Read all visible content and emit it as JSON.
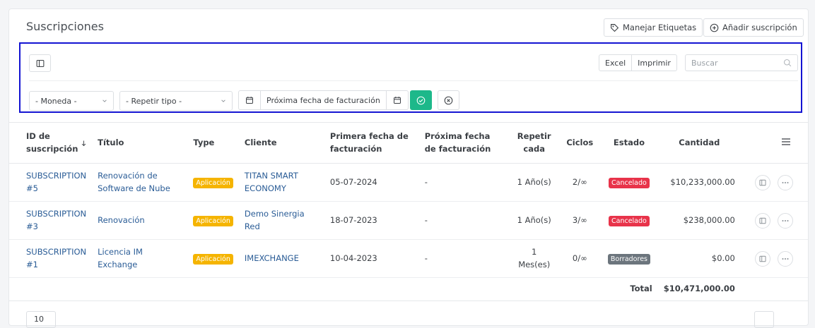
{
  "page": {
    "title": "Suscripciones"
  },
  "header": {
    "manage_tags": "Manejar Etiquetas",
    "add_subscription": "Añadir suscripción"
  },
  "toolbar": {
    "excel": "Excel",
    "print": "Imprimir",
    "search_placeholder": "Buscar",
    "currency_select": "- Moneda -",
    "repeat_type_select": "- Repetir tipo -",
    "next_billing_date": "Próxima fecha de facturación"
  },
  "table": {
    "headers": [
      "ID de suscripción",
      "Título",
      "Type",
      "Cliente",
      "Primera fecha de facturación",
      "Próxima fecha de facturación",
      "Repetir cada",
      "Ciclos",
      "Estado",
      "Cantidad"
    ],
    "rows": [
      {
        "id": "SUBSCRIPTION #5",
        "title": "Renovación de Software de Nube",
        "type": "Aplicación",
        "client": "TITAN SMART ECONOMY",
        "first_date": "05-07-2024",
        "next_date": "-",
        "repeat": "1 Año(s)",
        "cycles": "2/∞",
        "status": "Cancelado",
        "status_color": "#e8334a",
        "amount": "$10,233,000.00"
      },
      {
        "id": "SUBSCRIPTION #3",
        "title": "Renovación",
        "type": "Aplicación",
        "client": "Demo Sinergia Red",
        "first_date": "18-07-2023",
        "next_date": "-",
        "repeat": "1 Año(s)",
        "cycles": "3/∞",
        "status": "Cancelado",
        "status_color": "#e8334a",
        "amount": "$238,000.00"
      },
      {
        "id": "SUBSCRIPTION #1",
        "title": "Licencia IM Exchange",
        "type": "Aplicación",
        "client": "IMEXCHANGE",
        "first_date": "10-04-2023",
        "next_date": "-",
        "repeat": "1 Mes(es)",
        "cycles": "0/∞",
        "status": "Borradores",
        "status_color": "#6c757d",
        "amount": "$0.00"
      }
    ],
    "total_label": "Total",
    "total_value": "$10,471,000.00"
  },
  "pagination": {
    "page_size": "10"
  },
  "colors": {
    "accent_green": "#1db88a",
    "badge_yellow": "#f5b400",
    "link_blue": "#2a5c96",
    "toolbar_border": "#1414d2"
  }
}
